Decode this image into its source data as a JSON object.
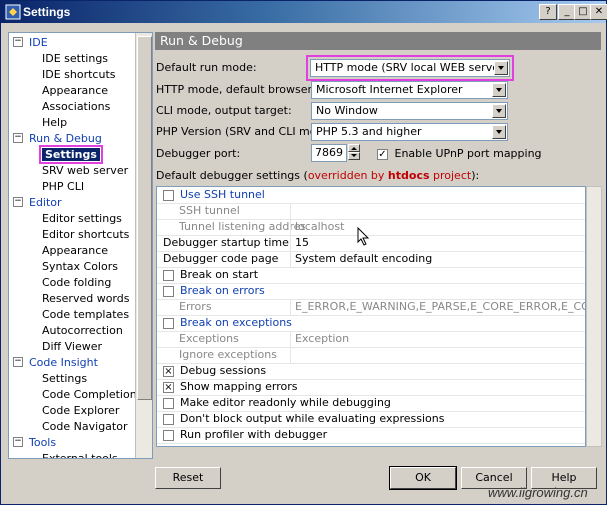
{
  "window": {
    "title": "Settings",
    "help_glyph": "?",
    "minimize_glyph": "_",
    "maximize_glyph": "□",
    "close_glyph": "✕"
  },
  "tree": {
    "categories": [
      {
        "label": "IDE",
        "expander": "−",
        "items": [
          "IDE settings",
          "IDE shortcuts",
          "Appearance",
          "Associations",
          "Help"
        ]
      },
      {
        "label": "Run & Debug",
        "expander": "−",
        "items": [
          "Settings",
          "SRV web server",
          "PHP CLI"
        ]
      },
      {
        "label": "Editor",
        "expander": "−",
        "items": [
          "Editor settings",
          "Editor shortcuts",
          "Appearance",
          "Syntax Colors",
          "Code folding",
          "Reserved words",
          "Code templates",
          "Autocorrection",
          "Diff Viewer"
        ]
      },
      {
        "label": "Code Insight",
        "expander": "−",
        "items": [
          "Settings",
          "Code Completion",
          "Code Explorer",
          "Code Navigator"
        ]
      },
      {
        "label": "Tools",
        "expander": "−",
        "items": [
          "External tools"
        ]
      }
    ],
    "selected": "Settings"
  },
  "panel": {
    "header": "Run & Debug",
    "run_mode": {
      "label": "Default run mode:",
      "value": "HTTP mode (SRV local WEB server)"
    },
    "browser": {
      "label": "HTTP mode, default browser:",
      "value": "Microsoft Internet Explorer"
    },
    "cli_target": {
      "label": "CLI mode, output target:",
      "value": "No Window"
    },
    "php_version": {
      "label": "PHP Version (SRV and CLI modes):",
      "value": "PHP 5.3 and higher"
    },
    "debugger_port": {
      "label": "Debugger port:",
      "value": "7869"
    },
    "upnp": {
      "label": "Enable UPnP port mapping",
      "checked": true,
      "mark": "✓"
    },
    "debugger_settings": {
      "prefix": "Default debugger settings (",
      "override": "overridden by ",
      "project_name": "htdocs",
      "project_word": " project",
      "suffix": "):"
    }
  },
  "grid": {
    "rows": [
      {
        "type": "check",
        "label": "Use SSH tunnel",
        "checked": false,
        "style": "blue"
      },
      {
        "type": "prop",
        "label": "SSH tunnel",
        "value": "",
        "style": "gray"
      },
      {
        "type": "prop",
        "label": "Tunnel listening address",
        "value": "localhost",
        "style": "gray"
      },
      {
        "type": "prop",
        "label": "Debugger startup timeout",
        "value": "15",
        "style": "normal"
      },
      {
        "type": "prop",
        "label": "Debugger code page",
        "value": "System default encoding",
        "style": "normal"
      },
      {
        "type": "check",
        "label": "Break on start",
        "checked": false,
        "style": "normal"
      },
      {
        "type": "check",
        "label": "Break on errors",
        "checked": false,
        "style": "blue"
      },
      {
        "type": "prop",
        "label": "Errors",
        "value": "E_ERROR,E_WARNING,E_PARSE,E_CORE_ERROR,E_CORE_WA...",
        "style": "gray"
      },
      {
        "type": "check",
        "label": "Break on exceptions",
        "checked": false,
        "style": "blue"
      },
      {
        "type": "prop",
        "label": "Exceptions",
        "value": "Exception",
        "style": "gray"
      },
      {
        "type": "prop",
        "label": "Ignore exceptions",
        "value": "",
        "style": "gray"
      },
      {
        "type": "check",
        "label": "Debug sessions",
        "checked": true,
        "style": "normal"
      },
      {
        "type": "check",
        "label": "Show mapping errors",
        "checked": true,
        "style": "normal"
      },
      {
        "type": "check",
        "label": "Make editor readonly while debugging",
        "checked": false,
        "style": "normal"
      },
      {
        "type": "check",
        "label": "Don't block output while evaluating expressions",
        "checked": false,
        "style": "normal"
      },
      {
        "type": "check",
        "label": "Run profiler with debugger",
        "checked": false,
        "style": "normal"
      }
    ],
    "check_mark": "×"
  },
  "buttons": {
    "reset": "Reset",
    "ok": "OK",
    "cancel": "Cancel",
    "help": "Help"
  },
  "watermark": "www.iigrowing.cn",
  "colors": {
    "title_start": "#0a246a",
    "title_end": "#a6caf0",
    "highlight": "#e040e0",
    "link_blue": "#1040b0",
    "override_red": "#c00000"
  }
}
